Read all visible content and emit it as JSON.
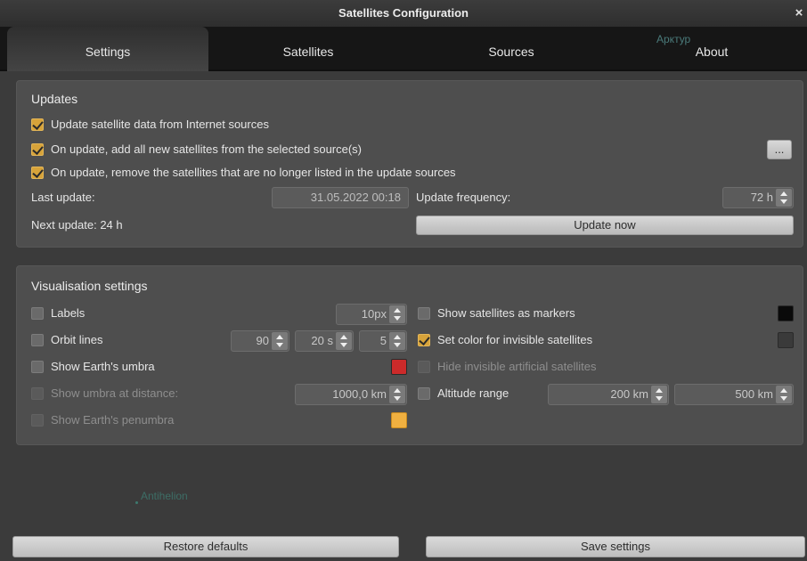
{
  "window": {
    "title": "Satellites Configuration",
    "close_label": "×"
  },
  "tabs": [
    {
      "label": "Settings",
      "active": true
    },
    {
      "label": "Satellites",
      "active": false
    },
    {
      "label": "Sources",
      "active": false
    },
    {
      "label": "About",
      "active": false
    }
  ],
  "sky_labels": {
    "arktur": "Арктур",
    "antihelion": "Antihelion"
  },
  "updates": {
    "title": "Updates",
    "update_from_internet": {
      "label": "Update satellite data from Internet sources",
      "checked": true
    },
    "add_new": {
      "label": "On update, add all new satellites from the selected source(s)",
      "checked": true
    },
    "remove_old": {
      "label": "On update, remove the satellites that are no longer listed in the update sources",
      "checked": true
    },
    "more_button": "...",
    "last_update_label": "Last update:",
    "last_update_value": "31.05.2022 00:18",
    "frequency_label": "Update frequency:",
    "frequency_value": "72 h",
    "next_update": "Next update: 24 h",
    "update_now": "Update now"
  },
  "visualisation": {
    "title": "Visualisation settings",
    "labels": {
      "label": "Labels",
      "checked": false,
      "value": "10px"
    },
    "orbit_lines": {
      "label": "Orbit lines",
      "checked": false,
      "segments": "90",
      "duration": "20 s",
      "thickness": "5"
    },
    "umbra": {
      "label": "Show Earth's umbra",
      "checked": false,
      "color": "#cc2a2a"
    },
    "umbra_distance": {
      "label": "Show umbra at distance:",
      "checked": false,
      "enabled": false,
      "value": "1000,0 km"
    },
    "penumbra": {
      "label": "Show Earth's penumbra",
      "checked": false,
      "enabled": false,
      "color": "#f0b040"
    },
    "markers": {
      "label": "Show satellites as markers",
      "checked": false,
      "color": "#0a0a0a"
    },
    "invisible_color": {
      "label": "Set color for invisible satellites",
      "checked": true,
      "color": "#3a3a3a"
    },
    "hide_invisible": {
      "label": "Hide invisible artificial satellites",
      "checked": false,
      "enabled": false
    },
    "altitude": {
      "label": "Altitude range",
      "checked": false,
      "min": "200 km",
      "max": "500 km"
    }
  },
  "footer": {
    "restore": "Restore defaults",
    "save": "Save settings"
  }
}
